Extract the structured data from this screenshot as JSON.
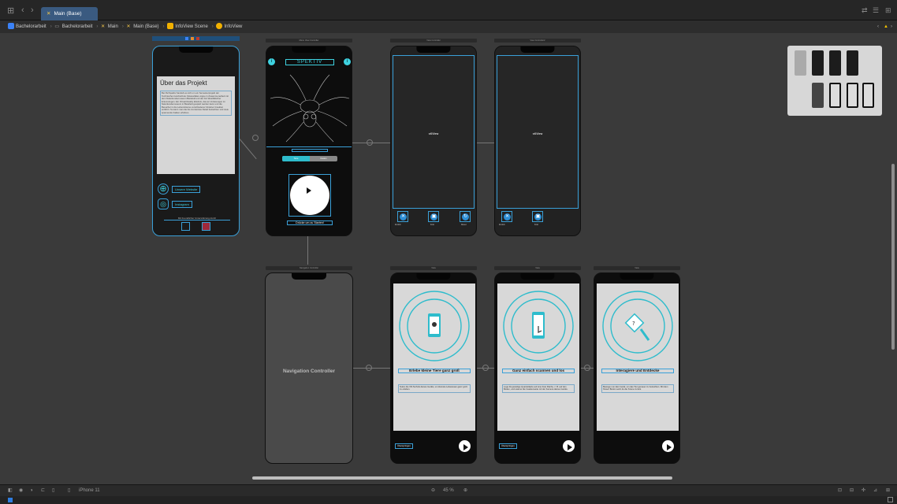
{
  "window": {
    "tab_label": "Main (Base)",
    "nav_back_icon": "chevron-left-icon",
    "nav_forward_icon": "chevron-right-icon",
    "grid_icon": "grid-icon"
  },
  "breadcrumb": {
    "items": [
      "Bachelorarbeit",
      "Bachelorarbeit",
      "Main",
      "Main (Base)",
      "InfoView Scene",
      "InfoView"
    ]
  },
  "scenes": {
    "info_scene": {
      "heading": "Über das Projekt",
      "body": "Bei PerSpektiv handelt es sich um ein Semesterprojekt der Technischen Hochschule Ostwestfalen-Lippe in Zusammenarbeit mit dem Naturkundemuseum Bielefeld und der AG Westfälischer Entomologen. Ein Virtual Reality Erlebnis, das an Vorlesungen im Naturkundemuseum in Bielefeld gespielt werden kann und die Besucher in die Lebensräume verschiedener Ukrainer Insekten entführt. So kann man die bis ins kleinste Detail betrachten und viele spannende Fakten erfahren.",
      "website_link": "Unsere Website",
      "instagram_link": "Instagram",
      "support_text": "Mit freundlicher Unterstützung durch"
    },
    "menu_scene": {
      "title": "Menu View Controller",
      "logo_text": "SPEKTIV",
      "segment_left": "Tiere",
      "segment_right": "Kasten",
      "start_label": "Drücke um zu Starten!"
    },
    "view_controller_1": {
      "title": "View Controller",
      "center": "sKView",
      "btn1": "Zurück",
      "btn2": "Foto",
      "btn3": "Reset"
    },
    "view_controller_2": {
      "title": "View Controller2",
      "center": "sKView",
      "btn1": "Zurück",
      "btn2": "Foto"
    },
    "nav_controller": {
      "title": "Navigation Controller",
      "label": "Navigation Controller"
    },
    "onboarding_1": {
      "title": "View",
      "heading": "Erlebe kleine Tiere ganz groß",
      "text": "Nutze die VR-Technik deines Geräts, um kleinste Lebewesen ganz groß zu erleben.",
      "skip": "Überspringen"
    },
    "onboarding_2": {
      "title": "View",
      "heading": "Ganz einfach scannen und los",
      "text": "Lege die jeweilige Quartettkarte auf eine freie Fläche, z. B. auf den Boden, und scanne die Insektenseite mit der Kamera deines Geräts.",
      "skip": "Überspringen"
    },
    "onboarding_3": {
      "title": "View",
      "heading": "Interagiere und Entdecke",
      "text": "Bewege nun dein Gerät, um das Tier genauer zu betrachten. Mit dem 'Reset' Button setzt du die Szene zurück."
    }
  },
  "bottombar": {
    "device": "iPhone 11",
    "zoom": "45 %"
  },
  "colors": {
    "accent": "#3ed2e0",
    "selection": "#3aa0d8",
    "tab": "#3a5a80"
  }
}
